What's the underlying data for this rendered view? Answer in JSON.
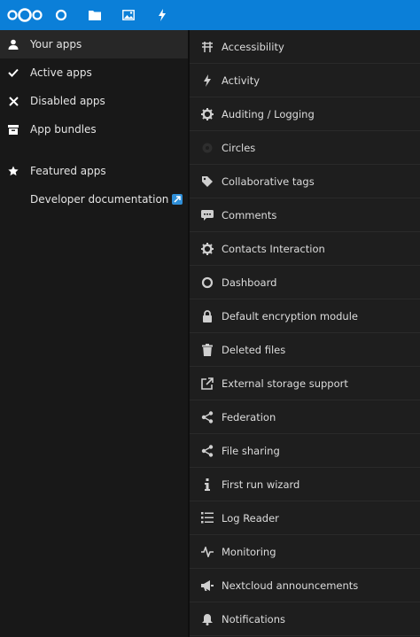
{
  "colors": {
    "header": "#0b7fd8",
    "sidebar_bg": "#181818",
    "list_bg": "#1e1e1e",
    "text": "#dcdcdc",
    "active_bg": "#272727"
  },
  "header": {
    "icons": [
      "nextcloud-logo",
      "dashboard-icon",
      "files-icon",
      "photos-icon",
      "activity-icon"
    ]
  },
  "sidebar": {
    "items": [
      {
        "label": "Your apps",
        "icon": "user-icon"
      },
      {
        "label": "Active apps",
        "icon": "check-icon"
      },
      {
        "label": "Disabled apps",
        "icon": "close-icon"
      },
      {
        "label": "App bundles",
        "icon": "archive-icon"
      },
      {
        "label": "Featured apps",
        "icon": "star-icon"
      },
      {
        "label": "Developer documentation",
        "icon": "external-link-icon"
      }
    ]
  },
  "apps": [
    {
      "name": "Accessibility",
      "icon": "accessibility-icon"
    },
    {
      "name": "Activity",
      "icon": "activity-icon"
    },
    {
      "name": "Auditing / Logging",
      "icon": "gear-icon"
    },
    {
      "name": "Circles",
      "icon": "circles-icon"
    },
    {
      "name": "Collaborative tags",
      "icon": "tag-icon"
    },
    {
      "name": "Comments",
      "icon": "comment-icon"
    },
    {
      "name": "Contacts Interaction",
      "icon": "gear-icon"
    },
    {
      "name": "Dashboard",
      "icon": "dashboard-icon"
    },
    {
      "name": "Default encryption module",
      "icon": "lock-icon"
    },
    {
      "name": "Deleted files",
      "icon": "trash-icon"
    },
    {
      "name": "External storage support",
      "icon": "external-icon"
    },
    {
      "name": "Federation",
      "icon": "share-icon"
    },
    {
      "name": "File sharing",
      "icon": "share-icon"
    },
    {
      "name": "First run wizard",
      "icon": "info-icon"
    },
    {
      "name": "Log Reader",
      "icon": "list-icon"
    },
    {
      "name": "Monitoring",
      "icon": "pulse-icon"
    },
    {
      "name": "Nextcloud announcements",
      "icon": "megaphone-icon"
    },
    {
      "name": "Notifications",
      "icon": "bell-icon"
    }
  ]
}
